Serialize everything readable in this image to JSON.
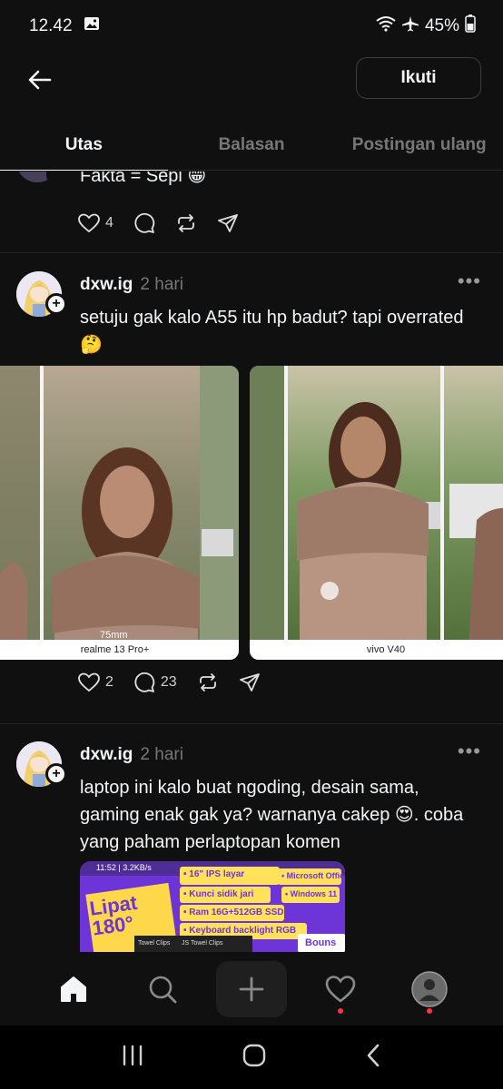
{
  "status": {
    "time": "12.42",
    "battery": "45%"
  },
  "header": {
    "follow_label": "Ikuti"
  },
  "tabs": [
    {
      "label": "Utas",
      "active": true
    },
    {
      "label": "Balasan",
      "active": false
    },
    {
      "label": "Postingan ulang",
      "active": false
    }
  ],
  "prev_post": {
    "text": "Fakta = Sepi 😁",
    "likes": "4"
  },
  "posts": [
    {
      "username": "dxw.ig",
      "time": "2 hari",
      "text": "setuju gak kalo A55 itu hp badut? tapi overrated 🤔",
      "media": [
        {
          "caption": "realme 13 Pro+",
          "overlay": "75mm"
        },
        {
          "caption": "vivo V40"
        }
      ],
      "likes": "2",
      "replies": "23"
    },
    {
      "username": "dxw.ig",
      "time": "2 hari",
      "text": "laptop ini kalo buat ngoding, desain sama, gaming enak gak ya? warnanya cakep 😍. coba yang paham perlaptopan komen",
      "image_texts": {
        "status": "11:52 | 3.2KB/s",
        "title": "Lipat 180°",
        "spec1": "• 16\" IPS layar",
        "spec2": "• Kunci sidik jari",
        "spec3": "• Ram 16G+512GB SSD",
        "spec4": "• Keyboard backlight RGB",
        "spec5": "• Microsoft Office",
        "spec6": "• Windows 11",
        "bonus": "Bouns",
        "tab1": "Towel Clips",
        "tab2": "JS Towel Clips"
      }
    }
  ],
  "colors": {
    "background": "#101010",
    "text": "#f3f5f7",
    "muted": "#777777",
    "notification": "#ff3040"
  }
}
